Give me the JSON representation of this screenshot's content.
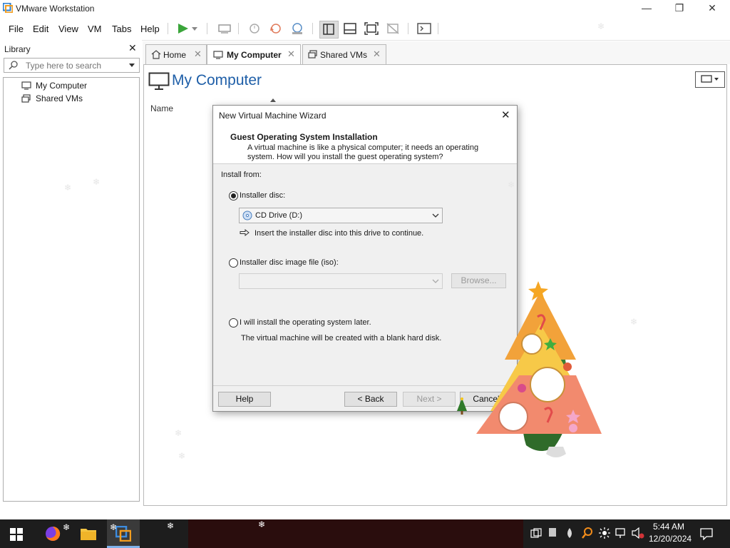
{
  "window": {
    "title": "VMware Workstation",
    "controls": {
      "minimize": "—",
      "maximize": "❐",
      "close": "✕"
    }
  },
  "menu": {
    "items": [
      "File",
      "Edit",
      "View",
      "VM",
      "Tabs",
      "Help"
    ]
  },
  "library": {
    "title": "Library",
    "close": "✕",
    "search_placeholder": "Type here to search",
    "tree": [
      {
        "label": "My Computer",
        "icon": "computer-icon"
      },
      {
        "label": "Shared VMs",
        "icon": "shared-vms-icon"
      }
    ]
  },
  "tabs": [
    {
      "label": "Home",
      "icon": "home-icon",
      "active": false
    },
    {
      "label": "My Computer",
      "icon": "computer-icon",
      "active": true
    },
    {
      "label": "Shared VMs",
      "icon": "shared-vms-icon",
      "active": false
    }
  ],
  "page": {
    "title": "My Computer",
    "column_name": "Name"
  },
  "dialog": {
    "title": "New Virtual Machine Wizard",
    "heading": "Guest Operating System Installation",
    "description_line1": "A virtual machine is like a physical computer; it needs an operating",
    "description_line2": "system. How will you install the guest operating system?",
    "install_from": "Install from:",
    "options": {
      "installer_disc": "Installer disc:",
      "disc_image": "Installer disc image file (iso):",
      "later": "I will install the operating system later."
    },
    "selected_option": "installer_disc",
    "drive_value": "CD Drive (D:)",
    "drive_hint": "Insert the installer disc into this drive to continue.",
    "iso_value": "",
    "browse_label": "Browse...",
    "later_hint": "The virtual machine will be created with a blank hard disk.",
    "buttons": {
      "help": "Help",
      "back": "< Back",
      "next": "Next >",
      "cancel": "Cancel"
    }
  },
  "taskbar": {
    "time": "5:44 AM",
    "date": "12/20/2024"
  },
  "colors": {
    "accent": "#1f5fa8",
    "taskbar": "#1d1d1d",
    "tree_orange": "#f2a23a",
    "tree_yellow": "#f7c948",
    "tree_coral": "#f28a6e"
  }
}
